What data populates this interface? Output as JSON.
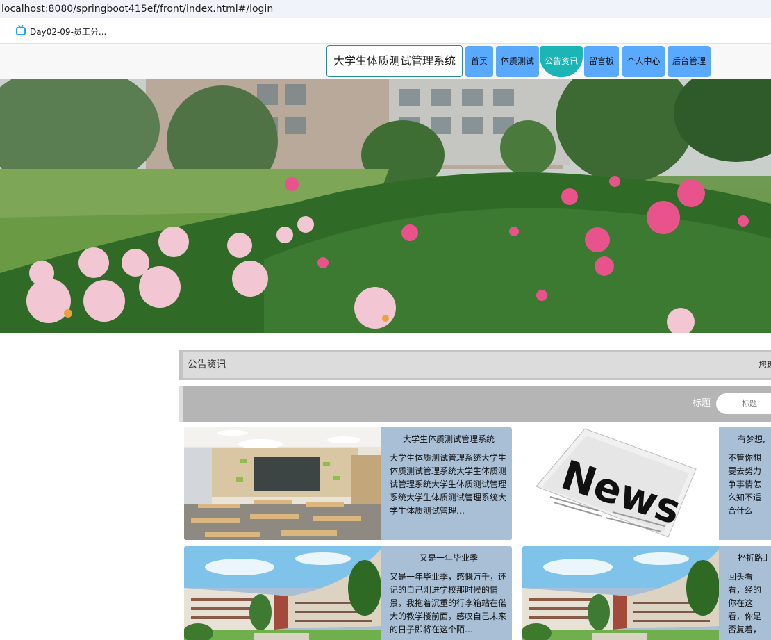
{
  "browser": {
    "url": "localhost:8080/springboot415ef/front/index.html#/login",
    "bookmark": "Day02-09-员工分..."
  },
  "nav": {
    "site_title": "大学生体质测试管理系统",
    "items": [
      {
        "label": "首页",
        "active": false
      },
      {
        "label": "体质测试",
        "active": false
      },
      {
        "label": "公告资讯",
        "active": true
      },
      {
        "label": "留言板",
        "active": false
      },
      {
        "label": "个人中心",
        "active": false
      },
      {
        "label": "后台管理",
        "active": false
      }
    ]
  },
  "section": {
    "title": "公告资讯",
    "right_text": "您现"
  },
  "search": {
    "label": "标题",
    "placeholder": "标题"
  },
  "cards": [
    {
      "title": "大学生体质测试管理系统",
      "body": "大学生体质测试管理系统大学生体质测试管理系统大学生体质测试管理系统大学生体质测试管理系统大学生体质测试管理系统大学生体质测试管理…",
      "image": "classroom"
    },
    {
      "title": "有梦想,",
      "body": "不管你想要去努力争事情怎么知不适合什么书，让我给",
      "image": "news"
    },
    {
      "title": "又是一年毕业季",
      "body": "又是一年毕业季，感慨万千，还记的自己刚进学校那时候的情景，我拖着沉重的行李箱站在偌大的教学楼前面，感叹自己未来的日子即将在这个陌…",
      "image": "campus"
    },
    {
      "title": "挫折路上",
      "body": "回头看看，经的你在这看，你是否复着，却今，让我们",
      "image": "campus"
    }
  ],
  "colors": {
    "nav_button": "#59a9ff",
    "nav_active": "#1bb5b5",
    "card_bg": "#a8bfd6"
  }
}
